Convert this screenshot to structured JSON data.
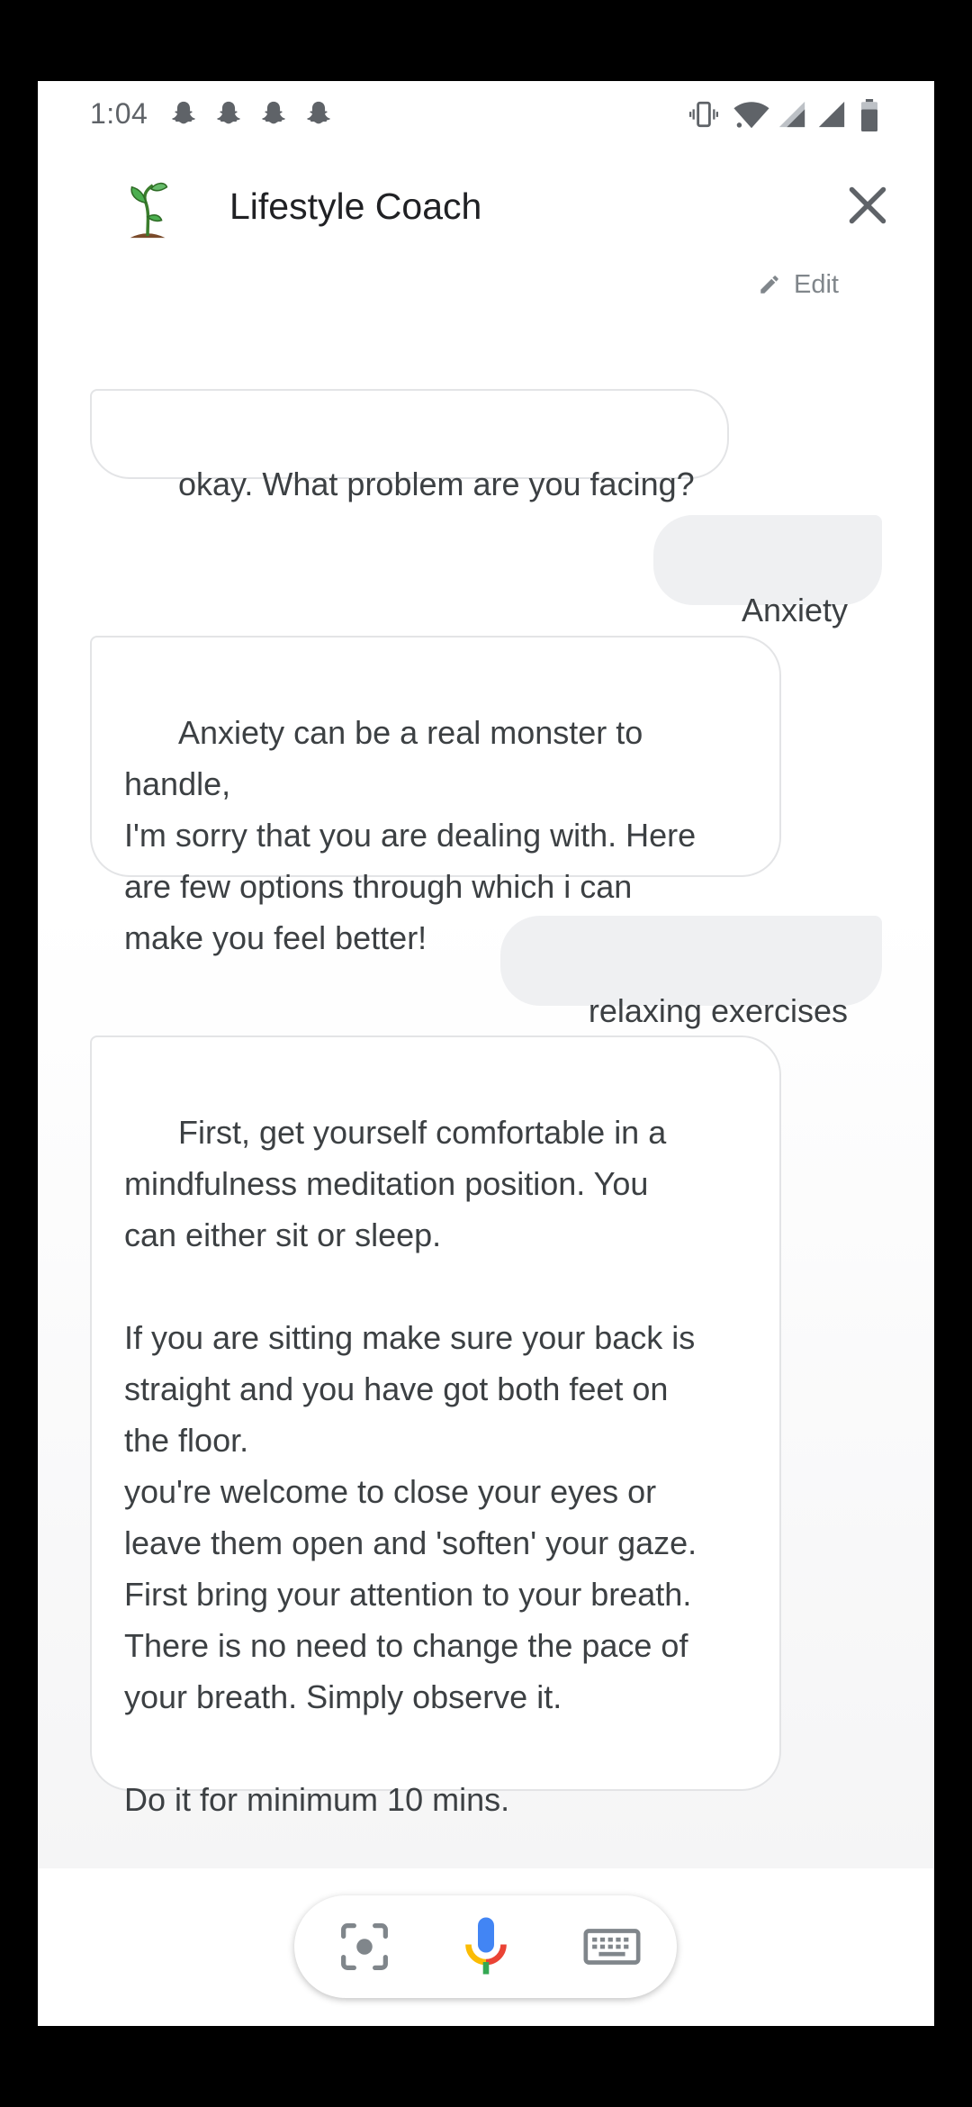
{
  "status_bar": {
    "time": "1:04",
    "notification_icons": [
      "snapchat-icon",
      "snapchat-icon",
      "snapchat-icon",
      "snapchat-icon"
    ],
    "right_icons": [
      "vibrate-icon",
      "wifi-icon",
      "signal-icon",
      "signal-icon",
      "battery-icon"
    ]
  },
  "header": {
    "title": "Lifestyle Coach",
    "avatar_icon": "sprout-icon",
    "close_icon": "close-icon"
  },
  "conversation": {
    "edit_label": "Edit",
    "messages": [
      {
        "role": "bot",
        "text": "okay. What problem are you facing?"
      },
      {
        "role": "user",
        "text": "Anxiety"
      },
      {
        "role": "bot",
        "text": "Anxiety can be a real monster to handle,\nI'm sorry that you are dealing with. Here\nare few options through which i can\nmake you feel better!"
      },
      {
        "role": "user",
        "text": "relaxing exercises"
      },
      {
        "role": "bot",
        "text": "First, get yourself comfortable in a\nmindfulness meditation position. You\ncan either sit or sleep.\n\nIf you are sitting make sure your back is\nstraight and you have got both feet on\nthe floor.\nyou're welcome to close your eyes or\nleave them open and 'soften' your gaze.\nFirst bring your attention to your breath.\nThere is no need to change the pace of\nyour breath. Simply observe it.\n\nDo it for minimum 10 mins."
      }
    ]
  },
  "bottom_bar": {
    "icons": [
      "lens-icon",
      "microphone-icon",
      "keyboard-icon"
    ]
  },
  "colors": {
    "mic_blue": "#4285f4",
    "mic_red": "#ea4335",
    "mic_yellow": "#fbbc04",
    "mic_green": "#34a853",
    "bubble_user": "#eff0f2",
    "bubble_border": "#e3e4e6"
  }
}
